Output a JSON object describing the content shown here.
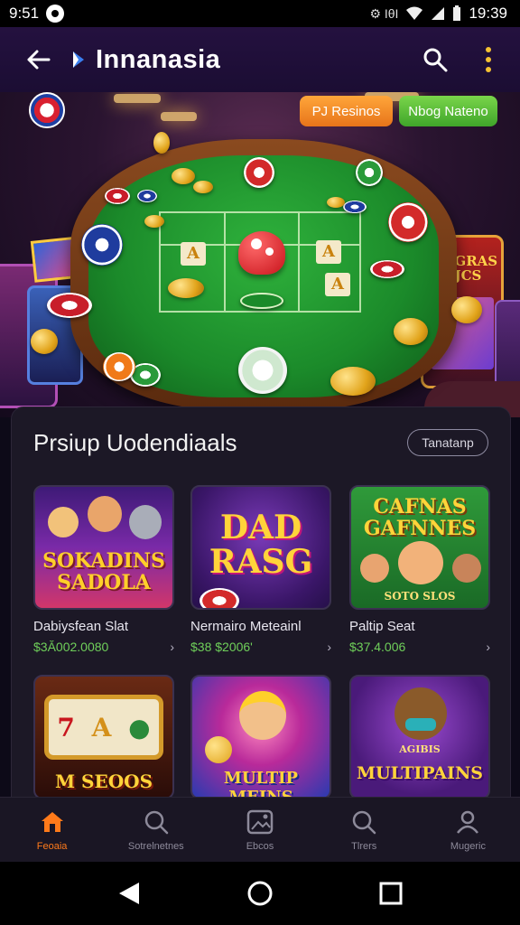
{
  "status_bar": {
    "time": "9:51",
    "indicators": "⚙ ΙθΙ",
    "clock": "19:39"
  },
  "app_bar": {
    "title": "Innanasia",
    "back_icon": "back-arrow-icon",
    "search_icon": "search-icon",
    "more_icon": "more-vertical-icon"
  },
  "hero": {
    "pill_orange": "PJ Resinos",
    "pill_green": "Nbog Nateno",
    "slot_sign": "MCGRAS SJCS",
    "accent_orange": "#f08a22",
    "accent_green": "#55bb35"
  },
  "section": {
    "title": "Prsiup Uodendiaals",
    "button": "Tanatanp"
  },
  "games": [
    {
      "thumb_text": "SOKADINS SADOLA",
      "name": "Dabiysfean Slat",
      "price": "$3Ă002.0080"
    },
    {
      "thumb_text": "DAD RASG",
      "name": "Nermairo Meteainl",
      "price": "$38 $2006'"
    },
    {
      "thumb_text": "CAFNAS GAFNNES",
      "name": "Paltip Seat",
      "price": "$37.4.006"
    },
    {
      "thumb_text": "M SEOOS",
      "name": "",
      "price": ""
    },
    {
      "thumb_text": "MULTIP MEINS",
      "name": "",
      "price": ""
    },
    {
      "thumb_text": "MULTIPAINS",
      "name": "",
      "price": ""
    }
  ],
  "thumb_extra": {
    "game3_sub": "SOTO SLOS",
    "game5_top": "AGIBIS"
  },
  "bottom_nav": [
    {
      "label": "Feoaia",
      "icon": "home-icon",
      "active": true
    },
    {
      "label": "Sotrelnetnes",
      "icon": "search-magnifier-icon",
      "active": false
    },
    {
      "label": "Ebcos",
      "icon": "image-icon",
      "active": false
    },
    {
      "label": "Tlrers",
      "icon": "search-icon",
      "active": false
    },
    {
      "label": "Mugeric",
      "icon": "profile-icon",
      "active": false
    }
  ],
  "system_nav": {
    "back": "nav-back-icon",
    "home": "nav-home-icon",
    "recents": "nav-recents-icon"
  }
}
